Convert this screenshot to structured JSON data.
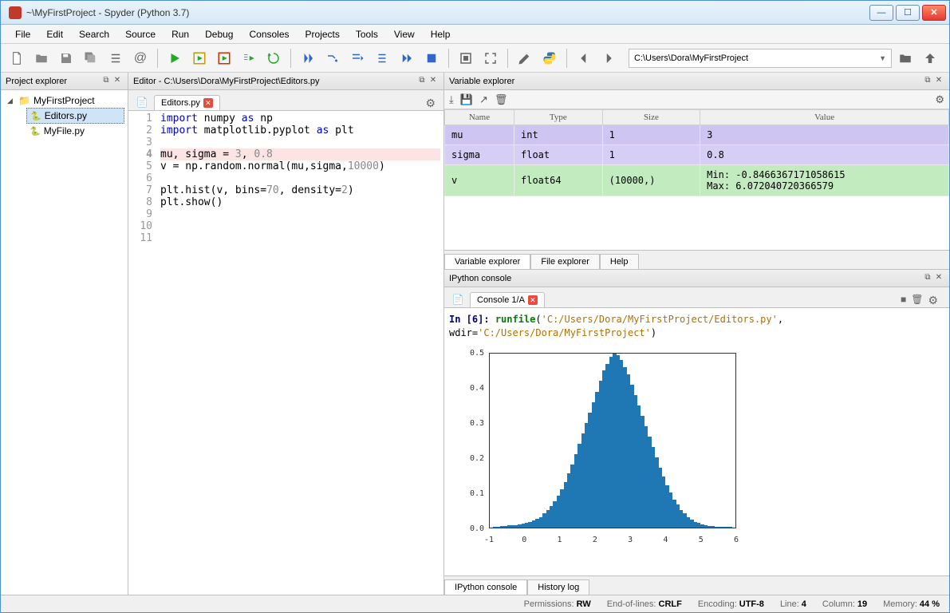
{
  "window": {
    "title": "~\\MyFirstProject - Spyder (Python 3.7)"
  },
  "menu": [
    "File",
    "Edit",
    "Search",
    "Source",
    "Run",
    "Debug",
    "Consoles",
    "Projects",
    "Tools",
    "View",
    "Help"
  ],
  "toolbar_path": "C:\\Users\\Dora\\MyFirstProject",
  "project_explorer": {
    "title": "Project explorer",
    "root": "MyFirstProject",
    "files": [
      "Editors.py",
      "MyFile.py"
    ],
    "selected": "Editors.py"
  },
  "editor": {
    "title": "Editor - C:\\Users\\Dora\\MyFirstProject\\Editors.py",
    "tab": "Editors.py",
    "highlighted_line": 4,
    "lines": [
      {
        "n": 1,
        "text": "import numpy as np",
        "tokens": [
          [
            "kw",
            "import"
          ],
          [
            "",
            " numpy "
          ],
          [
            "kw",
            "as"
          ],
          [
            "",
            " np"
          ]
        ]
      },
      {
        "n": 2,
        "text": "import matplotlib.pyplot as plt",
        "tokens": [
          [
            "kw",
            "import"
          ],
          [
            "",
            " matplotlib.pyplot "
          ],
          [
            "kw",
            "as"
          ],
          [
            "",
            " plt"
          ]
        ]
      },
      {
        "n": 3,
        "text": "",
        "tokens": []
      },
      {
        "n": 4,
        "text": "mu, sigma = 3, 0.8",
        "tokens": [
          [
            "",
            "mu, sigma = "
          ],
          [
            "num",
            "3"
          ],
          [
            "",
            ", "
          ],
          [
            "num",
            "0.8"
          ]
        ]
      },
      {
        "n": 5,
        "text": "v = np.random.normal(mu,sigma,10000)",
        "tokens": [
          [
            "",
            "v = np.random.normal(mu,sigma,"
          ],
          [
            "num",
            "10000"
          ],
          [
            "",
            ")"
          ]
        ]
      },
      {
        "n": 6,
        "text": "",
        "tokens": []
      },
      {
        "n": 7,
        "text": "plt.hist(v, bins=70, density=2)",
        "tokens": [
          [
            "",
            "plt.hist(v, bins="
          ],
          [
            "num",
            "70"
          ],
          [
            "",
            ", density="
          ],
          [
            "num",
            "2"
          ],
          [
            "",
            ")"
          ]
        ]
      },
      {
        "n": 8,
        "text": "plt.show()",
        "tokens": [
          [
            "",
            "plt.show()"
          ]
        ]
      },
      {
        "n": 9,
        "text": "",
        "tokens": []
      },
      {
        "n": 10,
        "text": "",
        "tokens": []
      },
      {
        "n": 11,
        "text": "",
        "tokens": []
      }
    ]
  },
  "variable_explorer": {
    "title": "Variable explorer",
    "columns": [
      "Name",
      "Type",
      "Size",
      "Value"
    ],
    "rows": [
      {
        "name": "mu",
        "type": "int",
        "size": "1",
        "value": "3",
        "cls": "row-purple"
      },
      {
        "name": "sigma",
        "type": "float",
        "size": "1",
        "value": "0.8",
        "cls": "row-purple2"
      },
      {
        "name": "v",
        "type": "float64",
        "size": "(10000,)",
        "value": "Min: -0.8466367171058615\nMax: 6.072040720366579",
        "cls": "row-green"
      }
    ],
    "tabs": [
      "Variable explorer",
      "File explorer",
      "Help"
    ],
    "active_tab": 0
  },
  "ipython": {
    "title": "IPython console",
    "tab": "Console 1/A",
    "prompt_num": "6",
    "prompt_label": "In [6]:",
    "runfile_call": "runfile",
    "runfile_arg1": "'C:/Users/Dora/MyFirstProject/Editors.py'",
    "runfile_wdir_kw": ", wdir=",
    "runfile_arg2": "'C:/Users/Dora/MyFirstProject'",
    "tabs": [
      "IPython console",
      "History log"
    ]
  },
  "chart_data": {
    "type": "bar",
    "title": "",
    "xlabel": "",
    "ylabel": "",
    "xlim": [
      -1,
      6
    ],
    "ylim": [
      0,
      0.5
    ],
    "xticks": [
      -1,
      0,
      1,
      2,
      3,
      4,
      5,
      6
    ],
    "yticks": [
      0.0,
      0.1,
      0.2,
      0.3,
      0.4,
      0.5
    ],
    "categories_note": "bins of np.random.normal(mu=3, sigma=0.8, n=10000), bins=70, density-normalized",
    "values": [
      0,
      0.001,
      0.002,
      0.003,
      0.004,
      0.005,
      0.006,
      0.007,
      0.008,
      0.01,
      0.012,
      0.015,
      0.02,
      0.025,
      0.03,
      0.04,
      0.05,
      0.06,
      0.075,
      0.09,
      0.11,
      0.13,
      0.155,
      0.18,
      0.21,
      0.24,
      0.27,
      0.3,
      0.33,
      0.36,
      0.39,
      0.42,
      0.45,
      0.47,
      0.49,
      0.5,
      0.495,
      0.48,
      0.46,
      0.44,
      0.41,
      0.38,
      0.35,
      0.32,
      0.29,
      0.26,
      0.23,
      0.2,
      0.17,
      0.145,
      0.12,
      0.1,
      0.08,
      0.065,
      0.05,
      0.04,
      0.03,
      0.022,
      0.016,
      0.012,
      0.008,
      0.006,
      0.004,
      0.003,
      0.002,
      0.0015,
      0.001,
      0.0005,
      0.0003,
      0.0001
    ]
  },
  "statusbar": {
    "permissions": {
      "label": "Permissions:",
      "value": "RW"
    },
    "eol": {
      "label": "End-of-lines:",
      "value": "CRLF"
    },
    "encoding": {
      "label": "Encoding:",
      "value": "UTF-8"
    },
    "line": {
      "label": "Line:",
      "value": "4"
    },
    "column": {
      "label": "Column:",
      "value": "19"
    },
    "memory": {
      "label": "Memory:",
      "value": "44 %"
    }
  }
}
